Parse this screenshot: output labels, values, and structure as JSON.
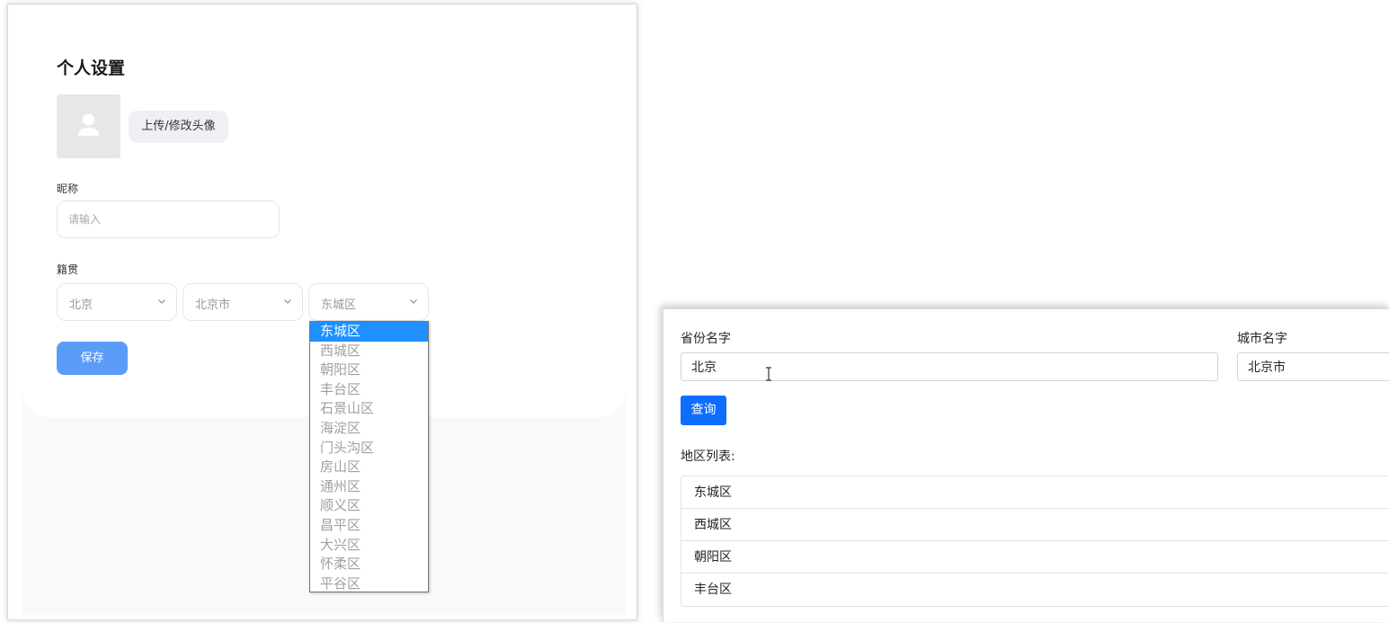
{
  "settings": {
    "title": "个人设置",
    "upload_avatar_label": "上传/修改头像",
    "nickname": {
      "label": "昵称",
      "placeholder": "请输入",
      "value": ""
    },
    "hometown": {
      "label": "籍贯",
      "province": "北京",
      "city": "北京市",
      "district": "东城区",
      "district_options": [
        "东城区",
        "西城区",
        "朝阳区",
        "丰台区",
        "石景山区",
        "海淀区",
        "门头沟区",
        "房山区",
        "通州区",
        "顺义区",
        "昌平区",
        "大兴区",
        "怀柔区",
        "平谷区"
      ],
      "selected_option": "东城区"
    },
    "save_label": "保存",
    "colors": {
      "save_button": "#5b9cf8",
      "selected_option": "#1e90ff"
    }
  },
  "query": {
    "province_label": "省份名字",
    "province_value": "北京",
    "city_label": "城市名字",
    "city_value": "北京市",
    "query_button": "查询",
    "region_list_label": "地区列表:",
    "regions": [
      "东城区",
      "西城区",
      "朝阳区",
      "丰台区"
    ],
    "colors": {
      "query_button": "#0d6efd"
    }
  },
  "icons": [
    "avatar-person-icon",
    "chevron-down-icon",
    "text-cursor-icon"
  ]
}
